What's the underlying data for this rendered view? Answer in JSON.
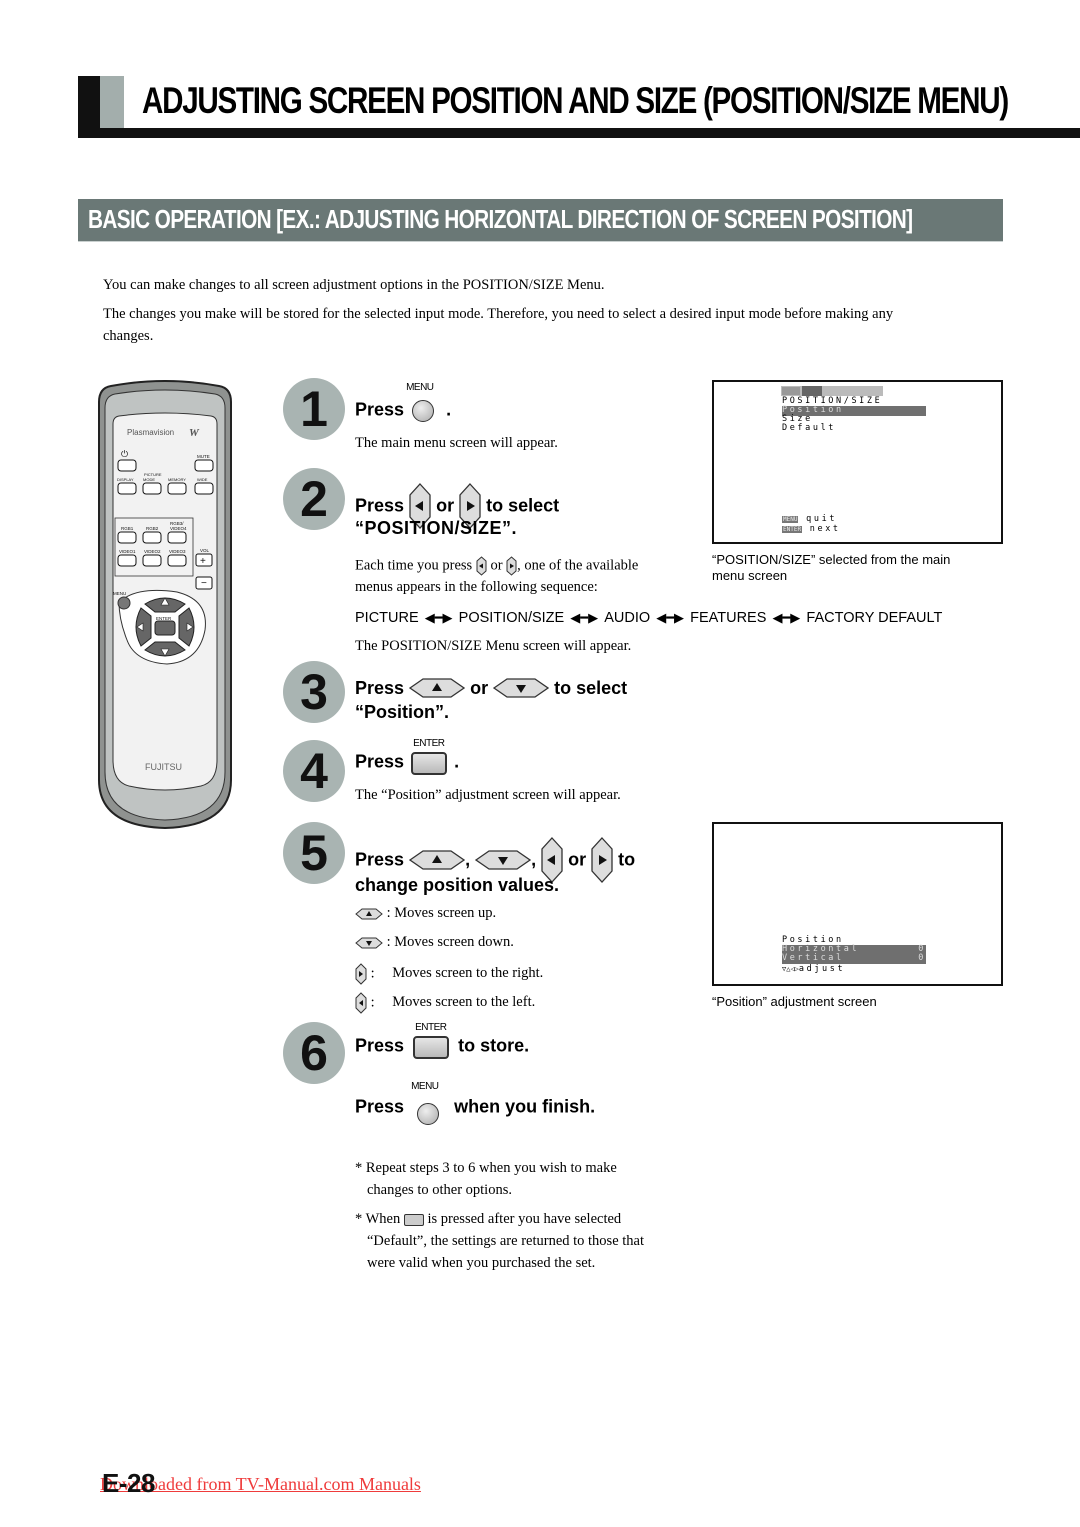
{
  "header": {
    "title": "ADJUSTING SCREEN POSITION AND SIZE (POSITION/SIZE MENU)",
    "subtitle": "BASIC OPERATION [EX.: ADJUSTING HORIZONTAL DIRECTION OF SCREEN POSITION]"
  },
  "intro": [
    "You can make changes to all screen adjustment options in the POSITION/SIZE Menu.",
    "The changes you make will be stored for the selected input mode.  Therefore, you need to select a desired input mode before making any",
    "changes."
  ],
  "remote": {
    "brand": "Plasmavision",
    "brand_mark": "W",
    "maker": "FUJITSU",
    "buttons": {
      "power": "⏻",
      "mute": "MUTE",
      "display": "DISPLAY",
      "picture_group": "PICTURE",
      "mode": "MODE",
      "memory": "MEMORY",
      "wide": "WIDE",
      "rgb1": "RGB1",
      "rgb2": "RGB2",
      "rgb3": "RGB3/",
      "video4": "VIDEO4",
      "video1": "VIDEO1",
      "video2": "VIDEO2",
      "video3": "VIDEO3",
      "vol": "VOL",
      "vol_plus": "+",
      "vol_minus": "−",
      "menu": "MENU",
      "enter": "ENTER"
    }
  },
  "buttons": {
    "menu_label": "MENU",
    "enter_label": "ENTER"
  },
  "steps": [
    {
      "num": "1",
      "press": "Press",
      "after": ".",
      "desc": "The main menu screen will appear."
    },
    {
      "num": "2",
      "press": "Press",
      "or": "or",
      "to_select": "to select",
      "target": "“POSITION/SIZE”.",
      "desc_a": "Each time you press",
      "desc_or": "or",
      "desc_b": ", one of the available",
      "desc_c": "menus appears in the following sequence:",
      "sequence": [
        "PICTURE",
        "POSITION/SIZE",
        "AUDIO",
        "FEATURES",
        "FACTORY DEFAULT"
      ],
      "after_seq": "The POSITION/SIZE Menu screen will appear."
    },
    {
      "num": "3",
      "press": "Press",
      "or": "or",
      "to_select": "to select",
      "target": "“Position”."
    },
    {
      "num": "4",
      "press": "Press",
      "after": ".",
      "desc": "The “Position” adjustment screen will appear."
    },
    {
      "num": "5",
      "press": "Press",
      "comma": ",",
      "or": "or",
      "to": "to",
      "line2": "change position values.",
      "legend": [
        {
          "key": "up",
          "text": ": Moves screen up."
        },
        {
          "key": "down",
          "text": ": Moves screen down."
        },
        {
          "key": "right",
          "text": "Moves screen to the right."
        },
        {
          "key": "left",
          "text": "Moves screen to the left."
        }
      ],
      "colon": ":"
    },
    {
      "num": "6",
      "press": "Press",
      "to_store": "to store.",
      "press2": "Press",
      "finish": "when you finish."
    }
  ],
  "notes": [
    {
      "star": "*",
      "line1": "Repeat steps 3 to 6 when you wish to make",
      "line2": "changes to other options."
    },
    {
      "star": "*",
      "a": "When",
      "b": "is pressed after you have selected",
      "line2": "“Default”, the settings are returned to those that",
      "line3": "were valid when you purchased the set."
    }
  ],
  "screen1": {
    "menu_title": "POSITION/SIZE",
    "items": [
      "Position",
      "Size",
      "Default"
    ],
    "selected": "Position",
    "footer": [
      {
        "key": "MENU",
        "text": "quit"
      },
      {
        "key": "ENTER",
        "text": "next"
      }
    ],
    "caption_line1": "“POSITION/SIZE” selected from the main",
    "caption_line2": "menu screen"
  },
  "screen2": {
    "title": "Position",
    "rows": [
      {
        "label": "Horizontal",
        "value": "0"
      },
      {
        "label": "Vertical",
        "value": "0"
      }
    ],
    "hint_arrows": "▽△◁▷",
    "hint": "adjust",
    "caption": "“Position” adjustment screen"
  },
  "footer": {
    "page": "E-28",
    "link": "Downloaded from TV-Manual.com Manuals"
  }
}
